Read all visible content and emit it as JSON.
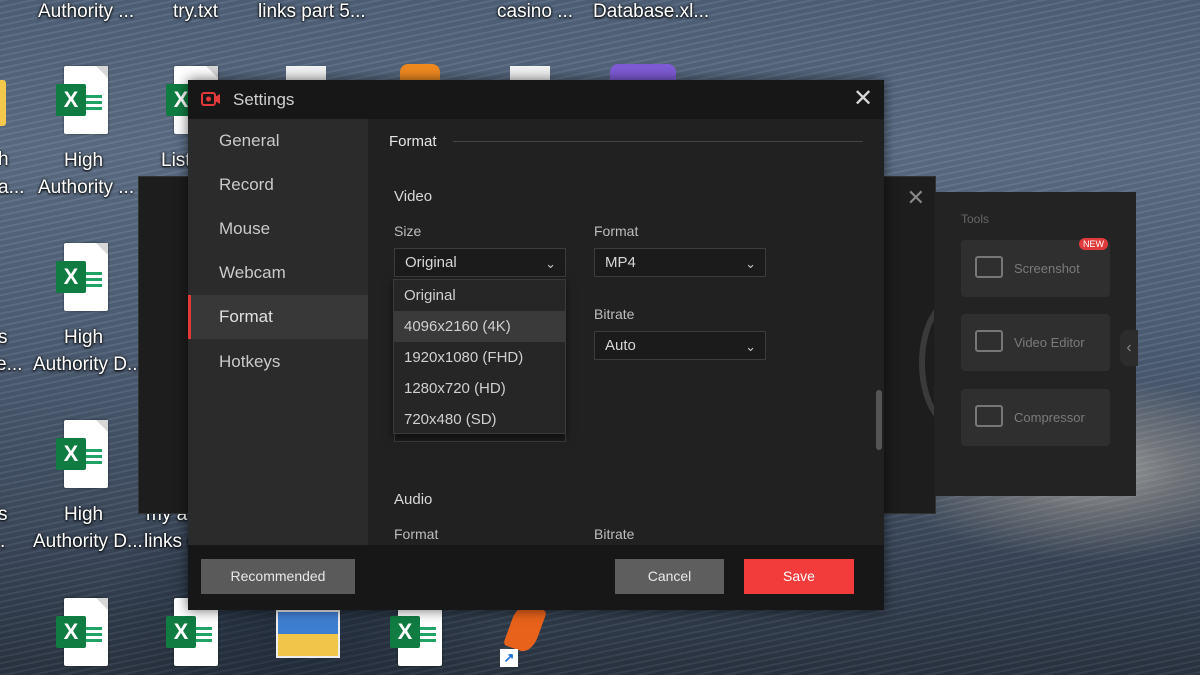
{
  "desktop": {
    "top_labels": [
      "Authority ...",
      "try.txt",
      "links part 5...",
      "casino ...",
      "Database.xl..."
    ],
    "icons": [
      {
        "label_lines": [
          "High",
          "Authority ..."
        ]
      },
      {
        "label_lines": [
          "List"
        ]
      },
      {
        "label_lines": [
          "High",
          "Authority D..."
        ]
      },
      {
        "label_lines": [
          "High",
          "Authority D..."
        ]
      },
      {
        "label_lines": [
          "my a",
          "links ("
        ]
      }
    ],
    "left_edge_fragments": [
      "h",
      "a...",
      "s",
      "e...",
      "s",
      "."
    ]
  },
  "background_app": {
    "tools_title": "Tools",
    "tools": [
      {
        "label": "Screenshot",
        "badge": "NEW"
      },
      {
        "label": "Video Editor",
        "badge": ""
      },
      {
        "label": "Compressor",
        "badge": ""
      }
    ]
  },
  "settings": {
    "title": "Settings",
    "close_glyph": "✕",
    "nav": [
      "General",
      "Record",
      "Mouse",
      "Webcam",
      "Format",
      "Hotkeys"
    ],
    "active_nav": "Format",
    "section_title": "Format",
    "video": {
      "heading": "Video",
      "size_label": "Size",
      "size_value": "Original",
      "format_label": "Format",
      "format_value": "MP4",
      "bitrate_label": "Bitrate",
      "bitrate_value": "Auto"
    },
    "size_options": [
      "Original",
      "4096x2160 (4K)",
      "1920x1080 (FHD)",
      "1280x720 (HD)",
      "720x480 (SD)"
    ],
    "highlighted_option": "4096x2160 (4K)",
    "audio": {
      "heading": "Audio",
      "format_label": "Format",
      "bitrate_label": "Bitrate"
    },
    "buttons": {
      "recommended": "Recommended",
      "cancel": "Cancel",
      "save": "Save"
    }
  },
  "colors": {
    "accent": "#f23b3b",
    "dialog_bg": "#212121",
    "sidebar_bg": "#2b2b2b"
  }
}
